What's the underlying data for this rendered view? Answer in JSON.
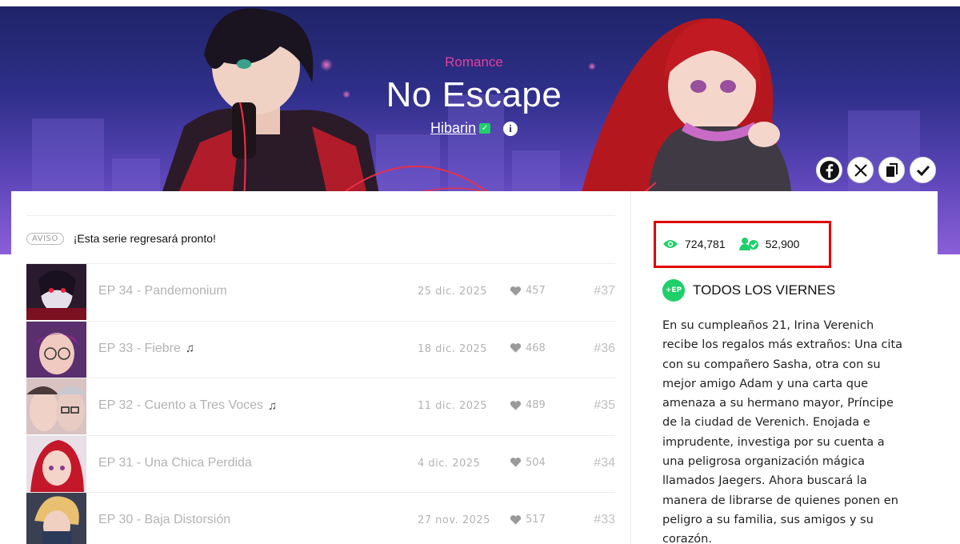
{
  "banner": {
    "genre": "Romance",
    "title": "No Escape",
    "author": "Hibarin",
    "share_buttons": [
      "facebook-icon",
      "x-icon",
      "copy-link-icon",
      "check-icon"
    ]
  },
  "notice": {
    "badge": "AVISO",
    "text": "¡Esta serie regresará pronto!"
  },
  "episodes": [
    {
      "title": "EP 34 - Pandemonium",
      "music": false,
      "date": "25 dic. 2025",
      "likes": "457",
      "number": "#37"
    },
    {
      "title": "EP 33 - Fiebre",
      "music": true,
      "date": "18 dic. 2025",
      "likes": "468",
      "number": "#36"
    },
    {
      "title": "EP 32 - Cuento a Tres Voces",
      "music": true,
      "date": "11 dic. 2025",
      "likes": "489",
      "number": "#35"
    },
    {
      "title": "EP 31 - Una Chica Perdida",
      "music": false,
      "date": "4 dic. 2025",
      "likes": "504",
      "number": "#34"
    },
    {
      "title": "EP 30 - Baja Distorsión",
      "music": false,
      "date": "27 nov. 2025",
      "likes": "517",
      "number": "#33"
    }
  ],
  "sidebar": {
    "views": "724,781",
    "subscribers": "52,900",
    "schedule_badge": "+EP",
    "schedule": "TODOS LOS VIERNES",
    "description": "En su cumpleaños 21, Irina Verenich recibe los regalos más extraños: Una cita con su compañero Sasha, otra con su mejor amigo Adam y una carta que amenaza a su hermano mayor, Príncipe de la ciudad de Verenich. Enojada e imprudente, investiga por su cuenta a una peligrosa organización mágica llamados Jaegers. Ahora buscará la manera de librarse de quienes ponen en peligro a su familia, sus amigos y su corazón."
  },
  "colors": {
    "accent_green": "#1fcf6a",
    "genre_pink": "#e33e9a",
    "highlight_red": "#e00000",
    "banner_top": "#1f2468",
    "banner_bottom": "#8a5fd8"
  }
}
